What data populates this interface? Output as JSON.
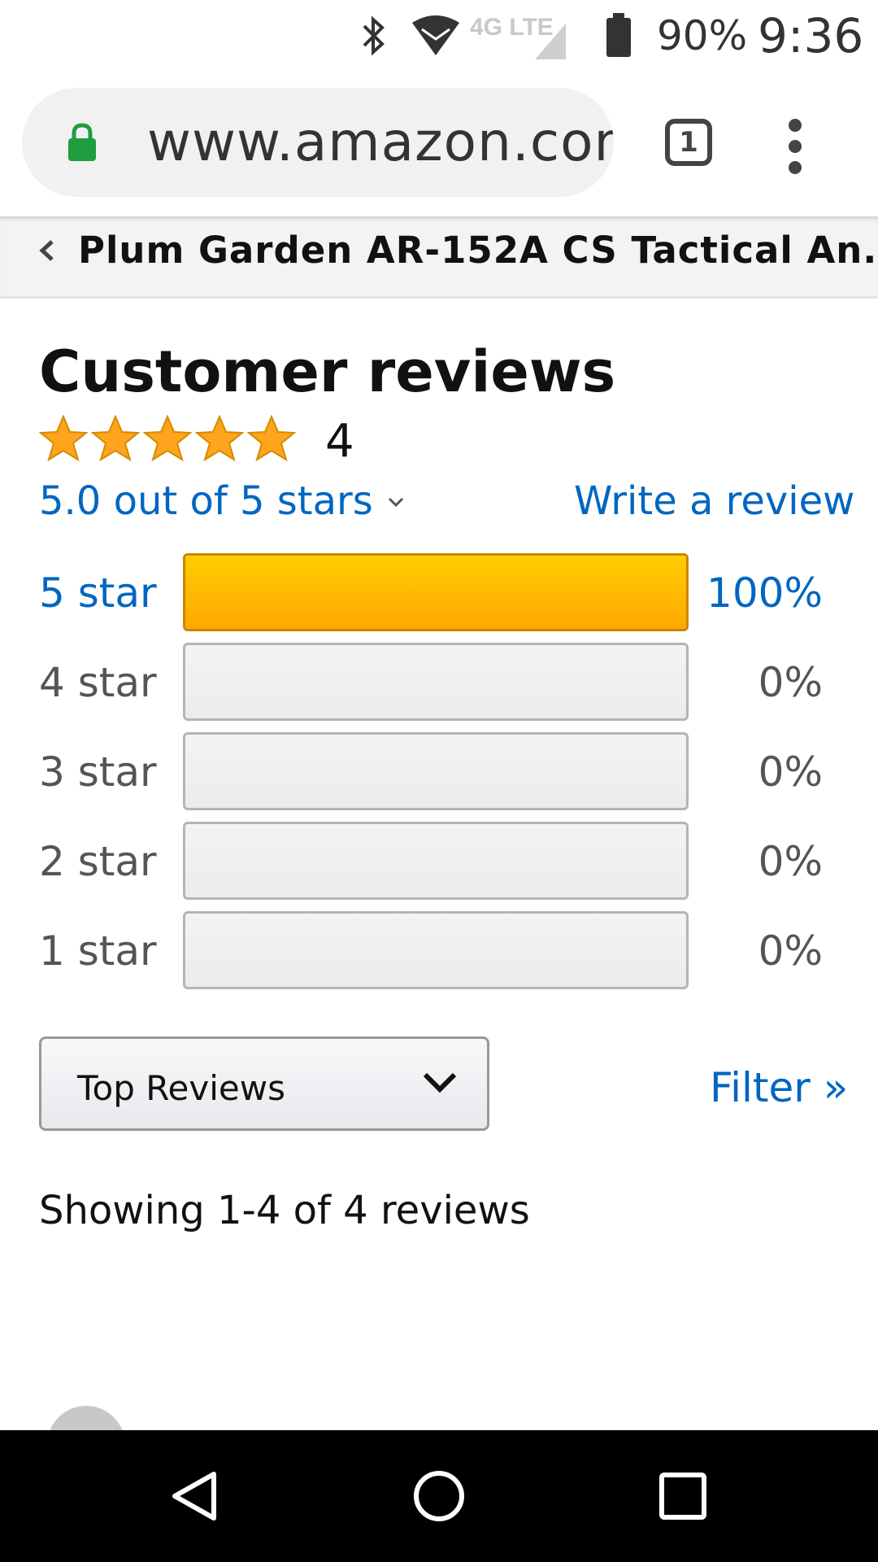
{
  "status_bar": {
    "network": "4G LTE",
    "battery_percent": "90%",
    "time": "9:36",
    "icons": [
      "bluetooth-icon",
      "wifi-icon",
      "signal-icon",
      "battery-icon"
    ]
  },
  "browser": {
    "url": "www.amazon.com",
    "tab_count": "1"
  },
  "breadcrumb": {
    "product_title": "Plum Garden AR-152A CS Tactical An..."
  },
  "reviews": {
    "heading": "Customer reviews",
    "rating_count": "4",
    "average_label": "5.0 out of 5 stars",
    "stars_filled": 5,
    "write_review": "Write a review",
    "histogram": [
      {
        "label": "5 star",
        "percent_text": "100%",
        "fraction": 1.0,
        "link": true
      },
      {
        "label": "4 star",
        "percent_text": "0%",
        "fraction": 0.0,
        "link": false
      },
      {
        "label": "3 star",
        "percent_text": "0%",
        "fraction": 0.0,
        "link": false
      },
      {
        "label": "2 star",
        "percent_text": "0%",
        "fraction": 0.0,
        "link": false
      },
      {
        "label": "1 star",
        "percent_text": "0%",
        "fraction": 0.0,
        "link": false
      }
    ],
    "sort_selected": "Top Reviews",
    "filter_link": "Filter »",
    "showing_text": "Showing 1-4 of 4 reviews"
  },
  "colors": {
    "link": "#0066c0",
    "star": "#ffa41c",
    "bar_fill": "#ffa700",
    "lock": "#1e9e3e"
  }
}
